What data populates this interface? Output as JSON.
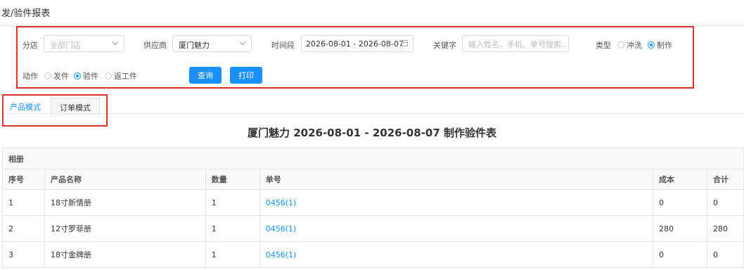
{
  "page": {
    "title": "发/验件报表"
  },
  "filters": {
    "store": {
      "label": "分店",
      "placeholder": "全部门店"
    },
    "supplier": {
      "label": "供应商",
      "value": "厦门魅力"
    },
    "date_range": {
      "label": "时间段",
      "value": "2026-08-01 - 2026-08-07"
    },
    "keyword": {
      "label": "关键字",
      "placeholder": "输入姓名、手机、单号搜索..."
    },
    "type": {
      "label": "类型",
      "options": [
        {
          "label": "冲洗",
          "checked": false
        },
        {
          "label": "制作",
          "checked": true
        }
      ]
    },
    "action": {
      "label": "动作",
      "options": [
        {
          "label": "发件",
          "checked": false
        },
        {
          "label": "验件",
          "checked": true
        },
        {
          "label": "返工件",
          "checked": false
        }
      ]
    },
    "query_label": "查询",
    "print_label": "打印"
  },
  "tabs": [
    {
      "label": "产品模式",
      "active": true
    },
    {
      "label": "订单模式",
      "active": false
    }
  ],
  "report": {
    "title": "厦门魅力 2026-08-01 - 2026-08-07 制作验件表",
    "group": "相册",
    "columns": [
      "序号",
      "产品名称",
      "数量",
      "单号",
      "成本",
      "合计"
    ],
    "rows": [
      [
        "1",
        "18寸新情册",
        "1",
        "0456(1)",
        "0",
        "0"
      ],
      [
        "2",
        "12寸罗菲册",
        "1",
        "0456(1)",
        "280",
        "280"
      ],
      [
        "3",
        "18寸金牌册",
        "1",
        "0456(1)",
        "0",
        "0"
      ]
    ]
  },
  "colors": {
    "accent": "#1890ff",
    "highlight_border": "#d9312b"
  }
}
